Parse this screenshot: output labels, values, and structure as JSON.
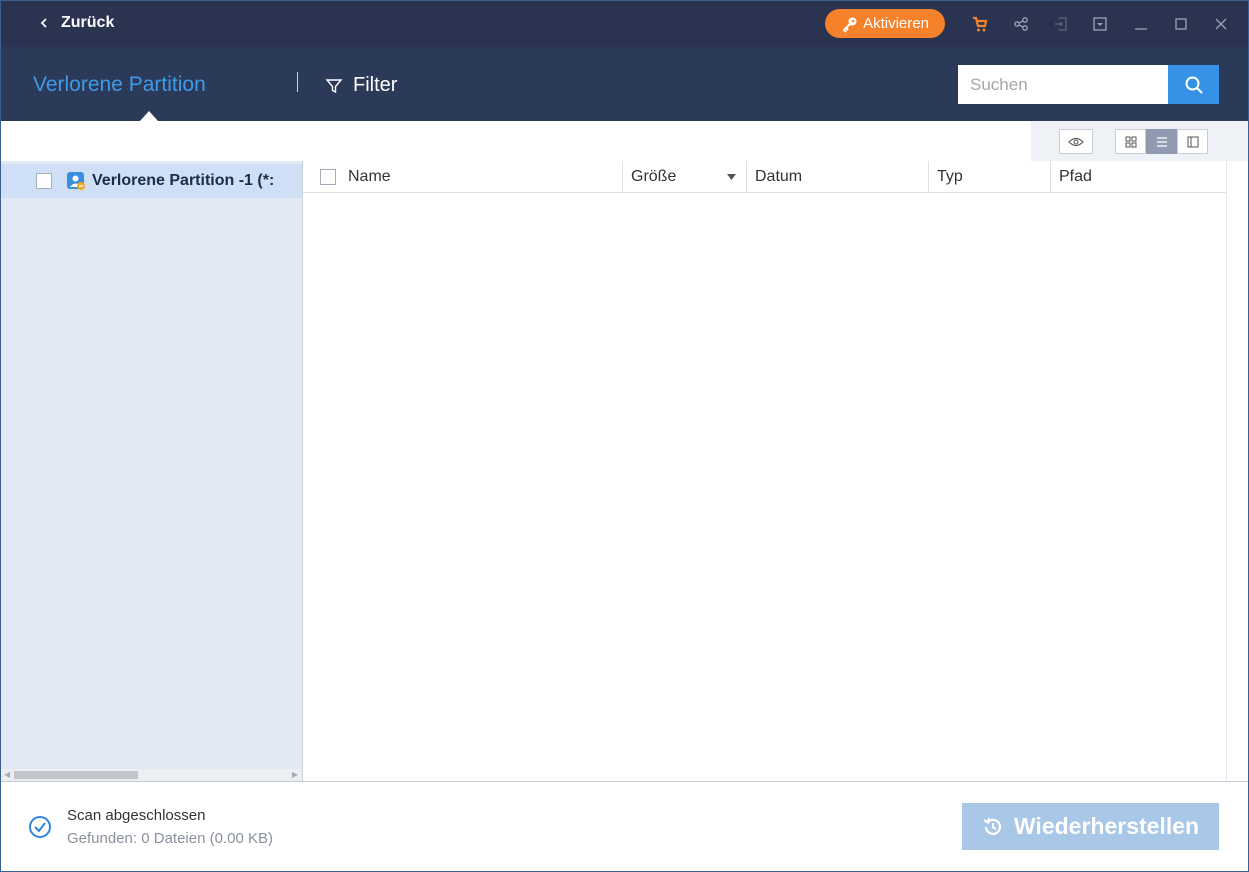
{
  "titlebar": {
    "back_label": "Zurück",
    "activate_label": "Aktivieren",
    "icons": [
      "cart-icon",
      "share-icon",
      "signin-icon",
      "dropdown-icon",
      "minimize-icon",
      "maximize-icon",
      "close-icon"
    ]
  },
  "header": {
    "active_tab": "Verlorene Partition",
    "filter_label": "Filter",
    "search_placeholder": "Suchen"
  },
  "tree": {
    "items": [
      {
        "label": "Verlorene Partition -1 (*:",
        "checked": false,
        "selected": true
      }
    ]
  },
  "table": {
    "columns": [
      "Name",
      "Größe",
      "Datum",
      "Typ",
      "Pfad"
    ],
    "sort_column": "Größe",
    "rows": []
  },
  "footer": {
    "status_title": "Scan abgeschlossen",
    "status_detail": "Gefunden: 0 Dateien (0.00 KB)",
    "recover_label": "Wiederherstellen"
  },
  "colors": {
    "titlebar_bg": "#2a3350",
    "header_bg": "#2c3a5a",
    "accent_blue": "#3592e6",
    "activate_orange": "#f5822a",
    "recover_disabled": "#a9c7e6"
  }
}
